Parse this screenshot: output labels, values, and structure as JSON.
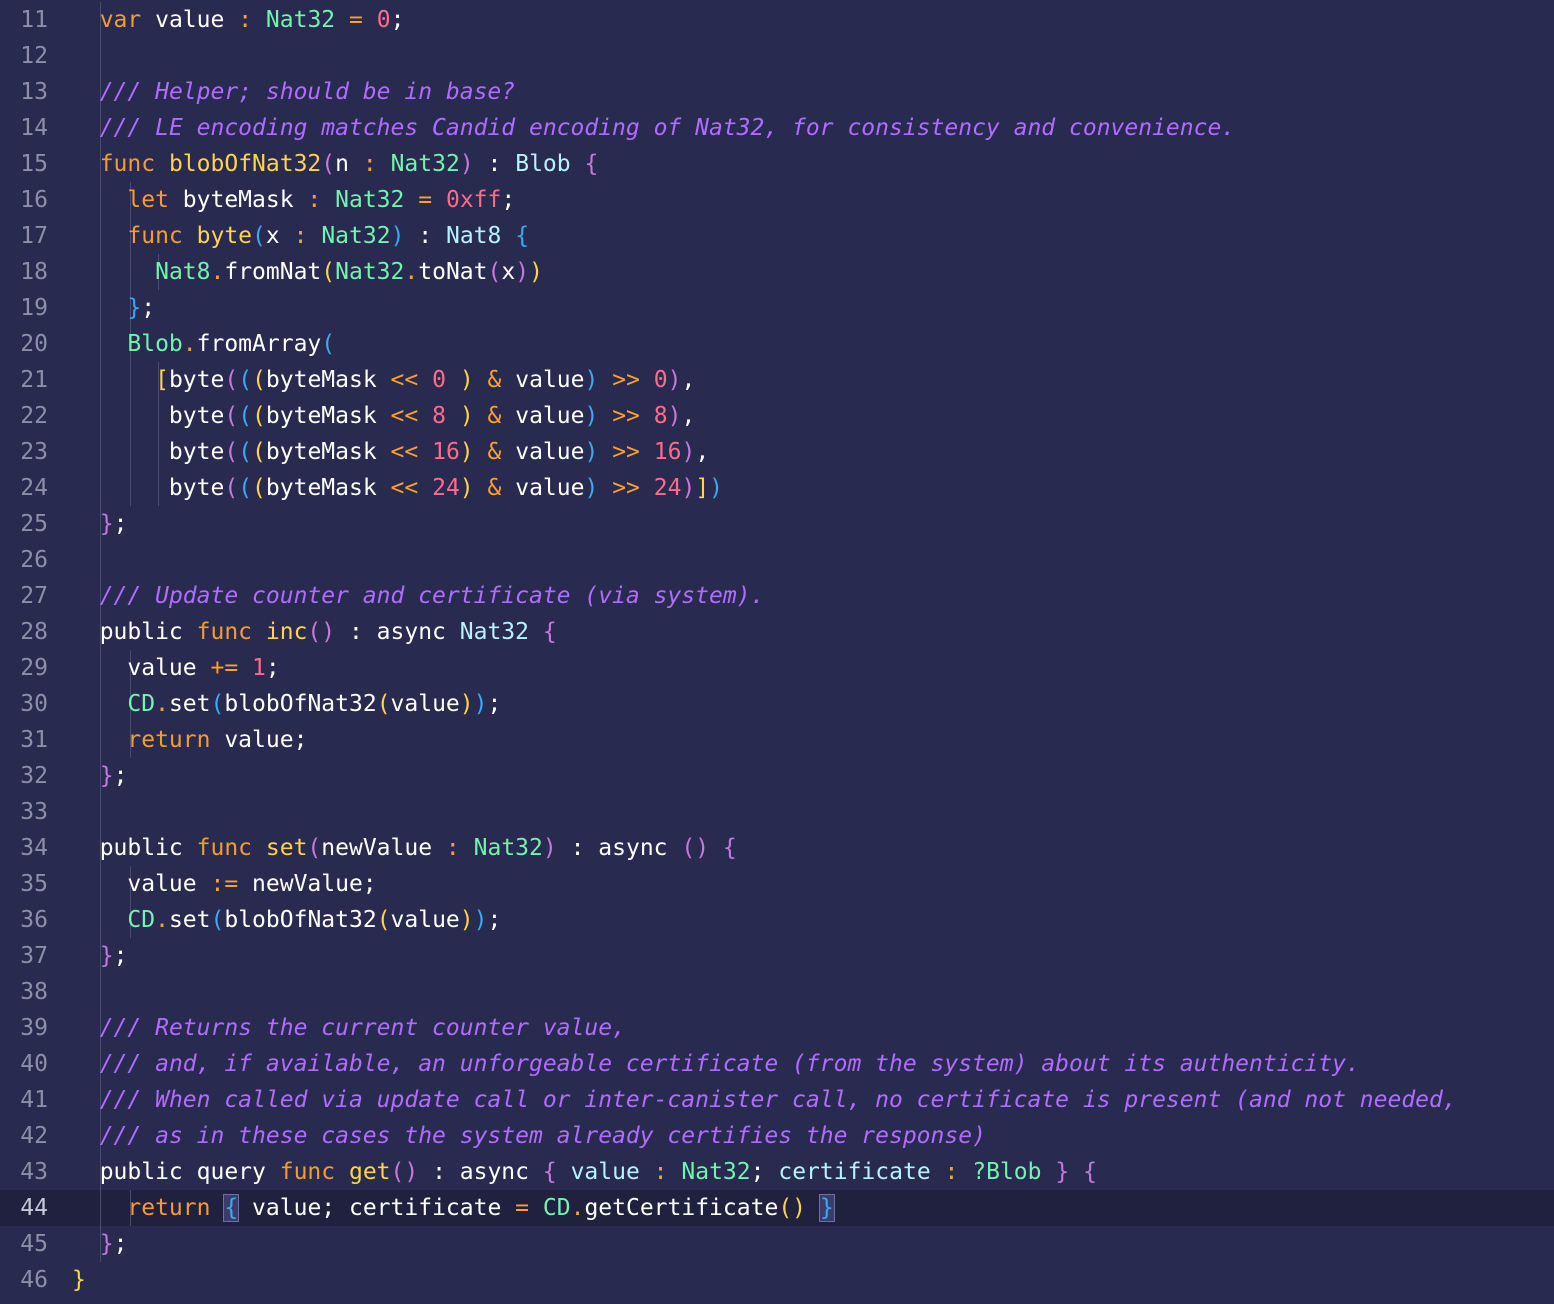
{
  "editor": {
    "current_line": 44,
    "lines": [
      {
        "n": "11",
        "tokens": [
          {
            "t": "  "
          },
          {
            "t": "var",
            "c": "kw"
          },
          {
            "t": " value "
          },
          {
            "t": ":",
            "c": "op"
          },
          {
            "t": " "
          },
          {
            "t": "Nat32",
            "c": "ty"
          },
          {
            "t": " "
          },
          {
            "t": "=",
            "c": "op"
          },
          {
            "t": " "
          },
          {
            "t": "0",
            "c": "num"
          },
          {
            "t": ";"
          }
        ]
      },
      {
        "n": "12",
        "tokens": []
      },
      {
        "n": "13",
        "tokens": [
          {
            "t": "  "
          },
          {
            "t": "/// Helper; should be in base?",
            "c": "cm"
          }
        ]
      },
      {
        "n": "14",
        "tokens": [
          {
            "t": "  "
          },
          {
            "t": "/// LE encoding matches Candid encoding of Nat32, for consistency and convenience.",
            "c": "cm"
          }
        ]
      },
      {
        "n": "15",
        "tokens": [
          {
            "t": "  "
          },
          {
            "t": "func",
            "c": "kw"
          },
          {
            "t": " "
          },
          {
            "t": "blobOfNat32",
            "c": "fn"
          },
          {
            "t": "(",
            "c": "p1"
          },
          {
            "t": "n "
          },
          {
            "t": ":",
            "c": "op"
          },
          {
            "t": " "
          },
          {
            "t": "Nat32",
            "c": "ty"
          },
          {
            "t": ")",
            "c": "p1"
          },
          {
            "t": " : "
          },
          {
            "t": "Blob",
            "c": "tyw"
          },
          {
            "t": " "
          },
          {
            "t": "{",
            "c": "p1"
          }
        ]
      },
      {
        "n": "16",
        "tokens": [
          {
            "t": "    "
          },
          {
            "t": "let",
            "c": "kw"
          },
          {
            "t": " byteMask "
          },
          {
            "t": ":",
            "c": "op"
          },
          {
            "t": " "
          },
          {
            "t": "Nat32",
            "c": "ty"
          },
          {
            "t": " "
          },
          {
            "t": "=",
            "c": "op"
          },
          {
            "t": " "
          },
          {
            "t": "0xff",
            "c": "num"
          },
          {
            "t": ";"
          }
        ]
      },
      {
        "n": "17",
        "tokens": [
          {
            "t": "    "
          },
          {
            "t": "func",
            "c": "kw"
          },
          {
            "t": " "
          },
          {
            "t": "byte",
            "c": "fn"
          },
          {
            "t": "(",
            "c": "p2"
          },
          {
            "t": "x "
          },
          {
            "t": ":",
            "c": "op"
          },
          {
            "t": " "
          },
          {
            "t": "Nat32",
            "c": "ty"
          },
          {
            "t": ")",
            "c": "p2"
          },
          {
            "t": " : "
          },
          {
            "t": "Nat8",
            "c": "tyw"
          },
          {
            "t": " "
          },
          {
            "t": "{",
            "c": "p2"
          }
        ]
      },
      {
        "n": "18",
        "tokens": [
          {
            "t": "      "
          },
          {
            "t": "Nat8",
            "c": "ty"
          },
          {
            "t": ".",
            "c": "op"
          },
          {
            "t": "fromNat"
          },
          {
            "t": "(",
            "c": "p3"
          },
          {
            "t": "Nat32",
            "c": "ty"
          },
          {
            "t": ".",
            "c": "op"
          },
          {
            "t": "toNat"
          },
          {
            "t": "(",
            "c": "p1"
          },
          {
            "t": "x"
          },
          {
            "t": ")",
            "c": "p1"
          },
          {
            "t": ")",
            "c": "p3"
          }
        ]
      },
      {
        "n": "19",
        "tokens": [
          {
            "t": "    "
          },
          {
            "t": "}",
            "c": "p2"
          },
          {
            "t": ";"
          }
        ]
      },
      {
        "n": "20",
        "tokens": [
          {
            "t": "    "
          },
          {
            "t": "Blob",
            "c": "ty"
          },
          {
            "t": ".",
            "c": "op"
          },
          {
            "t": "fromArray"
          },
          {
            "t": "(",
            "c": "p2"
          }
        ]
      },
      {
        "n": "21",
        "tokens": [
          {
            "t": "      "
          },
          {
            "t": "[",
            "c": "p3"
          },
          {
            "t": "byte"
          },
          {
            "t": "(",
            "c": "p1"
          },
          {
            "t": "(",
            "c": "p2"
          },
          {
            "t": "(",
            "c": "p3"
          },
          {
            "t": "byteMask "
          },
          {
            "t": "<<",
            "c": "op"
          },
          {
            "t": " "
          },
          {
            "t": "0",
            "c": "num"
          },
          {
            "t": " "
          },
          {
            "t": ")",
            "c": "p3"
          },
          {
            "t": " "
          },
          {
            "t": "&",
            "c": "op"
          },
          {
            "t": " value"
          },
          {
            "t": ")",
            "c": "p2"
          },
          {
            "t": " "
          },
          {
            "t": ">>",
            "c": "op"
          },
          {
            "t": " "
          },
          {
            "t": "0",
            "c": "num"
          },
          {
            "t": ")",
            "c": "p1"
          },
          {
            "t": ","
          }
        ]
      },
      {
        "n": "22",
        "tokens": [
          {
            "t": "       byte"
          },
          {
            "t": "(",
            "c": "p1"
          },
          {
            "t": "(",
            "c": "p2"
          },
          {
            "t": "(",
            "c": "p3"
          },
          {
            "t": "byteMask "
          },
          {
            "t": "<<",
            "c": "op"
          },
          {
            "t": " "
          },
          {
            "t": "8",
            "c": "num"
          },
          {
            "t": " "
          },
          {
            "t": ")",
            "c": "p3"
          },
          {
            "t": " "
          },
          {
            "t": "&",
            "c": "op"
          },
          {
            "t": " value"
          },
          {
            "t": ")",
            "c": "p2"
          },
          {
            "t": " "
          },
          {
            "t": ">>",
            "c": "op"
          },
          {
            "t": " "
          },
          {
            "t": "8",
            "c": "num"
          },
          {
            "t": ")",
            "c": "p1"
          },
          {
            "t": ","
          }
        ]
      },
      {
        "n": "23",
        "tokens": [
          {
            "t": "       byte"
          },
          {
            "t": "(",
            "c": "p1"
          },
          {
            "t": "(",
            "c": "p2"
          },
          {
            "t": "(",
            "c": "p3"
          },
          {
            "t": "byteMask "
          },
          {
            "t": "<<",
            "c": "op"
          },
          {
            "t": " "
          },
          {
            "t": "16",
            "c": "num"
          },
          {
            "t": ")",
            "c": "p3"
          },
          {
            "t": " "
          },
          {
            "t": "&",
            "c": "op"
          },
          {
            "t": " value"
          },
          {
            "t": ")",
            "c": "p2"
          },
          {
            "t": " "
          },
          {
            "t": ">>",
            "c": "op"
          },
          {
            "t": " "
          },
          {
            "t": "16",
            "c": "num"
          },
          {
            "t": ")",
            "c": "p1"
          },
          {
            "t": ","
          }
        ]
      },
      {
        "n": "24",
        "tokens": [
          {
            "t": "       byte"
          },
          {
            "t": "(",
            "c": "p1"
          },
          {
            "t": "(",
            "c": "p2"
          },
          {
            "t": "(",
            "c": "p3"
          },
          {
            "t": "byteMask "
          },
          {
            "t": "<<",
            "c": "op"
          },
          {
            "t": " "
          },
          {
            "t": "24",
            "c": "num"
          },
          {
            "t": ")",
            "c": "p3"
          },
          {
            "t": " "
          },
          {
            "t": "&",
            "c": "op"
          },
          {
            "t": " value"
          },
          {
            "t": ")",
            "c": "p2"
          },
          {
            "t": " "
          },
          {
            "t": ">>",
            "c": "op"
          },
          {
            "t": " "
          },
          {
            "t": "24",
            "c": "num"
          },
          {
            "t": ")",
            "c": "p1"
          },
          {
            "t": "]",
            "c": "p3"
          },
          {
            "t": ")",
            "c": "p2"
          }
        ]
      },
      {
        "n": "25",
        "tokens": [
          {
            "t": "  "
          },
          {
            "t": "}",
            "c": "p1"
          },
          {
            "t": ";"
          }
        ]
      },
      {
        "n": "26",
        "tokens": []
      },
      {
        "n": "27",
        "tokens": [
          {
            "t": "  "
          },
          {
            "t": "/// Update counter and certificate (via system).",
            "c": "cm"
          }
        ]
      },
      {
        "n": "28",
        "tokens": [
          {
            "t": "  public "
          },
          {
            "t": "func",
            "c": "kw"
          },
          {
            "t": " "
          },
          {
            "t": "inc",
            "c": "fn"
          },
          {
            "t": "()",
            "c": "p1"
          },
          {
            "t": " : async "
          },
          {
            "t": "Nat32",
            "c": "tyw"
          },
          {
            "t": " "
          },
          {
            "t": "{",
            "c": "p1"
          }
        ]
      },
      {
        "n": "29",
        "tokens": [
          {
            "t": "    value "
          },
          {
            "t": "+=",
            "c": "op"
          },
          {
            "t": " "
          },
          {
            "t": "1",
            "c": "num"
          },
          {
            "t": ";"
          }
        ]
      },
      {
        "n": "30",
        "tokens": [
          {
            "t": "    "
          },
          {
            "t": "CD",
            "c": "ty"
          },
          {
            "t": ".",
            "c": "op"
          },
          {
            "t": "set"
          },
          {
            "t": "(",
            "c": "p2"
          },
          {
            "t": "blobOfNat32"
          },
          {
            "t": "(",
            "c": "p3"
          },
          {
            "t": "value"
          },
          {
            "t": ")",
            "c": "p3"
          },
          {
            "t": ")",
            "c": "p2"
          },
          {
            "t": ";"
          }
        ]
      },
      {
        "n": "31",
        "tokens": [
          {
            "t": "    "
          },
          {
            "t": "return",
            "c": "kw"
          },
          {
            "t": " value;"
          }
        ]
      },
      {
        "n": "32",
        "tokens": [
          {
            "t": "  "
          },
          {
            "t": "}",
            "c": "p1"
          },
          {
            "t": ";"
          }
        ]
      },
      {
        "n": "33",
        "tokens": []
      },
      {
        "n": "34",
        "tokens": [
          {
            "t": "  public "
          },
          {
            "t": "func",
            "c": "kw"
          },
          {
            "t": " "
          },
          {
            "t": "set",
            "c": "fn"
          },
          {
            "t": "(",
            "c": "p1"
          },
          {
            "t": "newValue "
          },
          {
            "t": ":",
            "c": "op"
          },
          {
            "t": " "
          },
          {
            "t": "Nat32",
            "c": "ty"
          },
          {
            "t": ")",
            "c": "p1"
          },
          {
            "t": " : async "
          },
          {
            "t": "()",
            "c": "p1"
          },
          {
            "t": " "
          },
          {
            "t": "{",
            "c": "p1"
          }
        ]
      },
      {
        "n": "35",
        "tokens": [
          {
            "t": "    value "
          },
          {
            "t": ":=",
            "c": "op"
          },
          {
            "t": " newValue;"
          }
        ]
      },
      {
        "n": "36",
        "tokens": [
          {
            "t": "    "
          },
          {
            "t": "CD",
            "c": "ty"
          },
          {
            "t": ".",
            "c": "op"
          },
          {
            "t": "set"
          },
          {
            "t": "(",
            "c": "p2"
          },
          {
            "t": "blobOfNat32"
          },
          {
            "t": "(",
            "c": "p3"
          },
          {
            "t": "value"
          },
          {
            "t": ")",
            "c": "p3"
          },
          {
            "t": ")",
            "c": "p2"
          },
          {
            "t": ";"
          }
        ]
      },
      {
        "n": "37",
        "tokens": [
          {
            "t": "  "
          },
          {
            "t": "}",
            "c": "p1"
          },
          {
            "t": ";"
          }
        ]
      },
      {
        "n": "38",
        "tokens": []
      },
      {
        "n": "39",
        "tokens": [
          {
            "t": "  "
          },
          {
            "t": "/// Returns the current counter value,",
            "c": "cm"
          }
        ]
      },
      {
        "n": "40",
        "tokens": [
          {
            "t": "  "
          },
          {
            "t": "/// and, if available, an unforgeable certificate (from the system) about its authenticity.",
            "c": "cm"
          }
        ]
      },
      {
        "n": "41",
        "tokens": [
          {
            "t": "  "
          },
          {
            "t": "/// When called via update call or inter-canister call, no certificate is present (and not needed,",
            "c": "cm"
          }
        ]
      },
      {
        "n": "42",
        "tokens": [
          {
            "t": "  "
          },
          {
            "t": "/// as in these cases the system already certifies the response)",
            "c": "cm"
          }
        ]
      },
      {
        "n": "43",
        "tokens": [
          {
            "t": "  public query "
          },
          {
            "t": "func",
            "c": "kw"
          },
          {
            "t": " "
          },
          {
            "t": "get",
            "c": "fn"
          },
          {
            "t": "()",
            "c": "p1"
          },
          {
            "t": " : async "
          },
          {
            "t": "{",
            "c": "p1"
          },
          {
            "t": " "
          },
          {
            "t": "value",
            "c": "tyw"
          },
          {
            "t": " "
          },
          {
            "t": ":",
            "c": "op"
          },
          {
            "t": " "
          },
          {
            "t": "Nat32",
            "c": "ty"
          },
          {
            "t": "; "
          },
          {
            "t": "certificate",
            "c": "tyw"
          },
          {
            "t": " "
          },
          {
            "t": ":",
            "c": "op"
          },
          {
            "t": " "
          },
          {
            "t": "?Blob",
            "c": "ty"
          },
          {
            "t": " "
          },
          {
            "t": "}",
            "c": "p1"
          },
          {
            "t": " "
          },
          {
            "t": "{",
            "c": "p1"
          }
        ]
      },
      {
        "n": "44",
        "tokens": [
          {
            "t": "    "
          },
          {
            "t": "return",
            "c": "kw"
          },
          {
            "t": " "
          },
          {
            "t": "{",
            "c": "p2",
            "box": true
          },
          {
            "t": " value; certificate "
          },
          {
            "t": "=",
            "c": "op"
          },
          {
            "t": " "
          },
          {
            "t": "CD",
            "c": "ty"
          },
          {
            "t": ".",
            "c": "op"
          },
          {
            "t": "getCertificate"
          },
          {
            "t": "()",
            "c": "p3"
          },
          {
            "t": " "
          },
          {
            "t": "}",
            "c": "p2",
            "box": true
          }
        ]
      },
      {
        "n": "45",
        "tokens": [
          {
            "t": "  "
          },
          {
            "t": "}",
            "c": "p1"
          },
          {
            "t": ";"
          }
        ]
      },
      {
        "n": "46",
        "tokens": [
          {
            "t": "}",
            "c": "p3"
          }
        ]
      }
    ]
  }
}
